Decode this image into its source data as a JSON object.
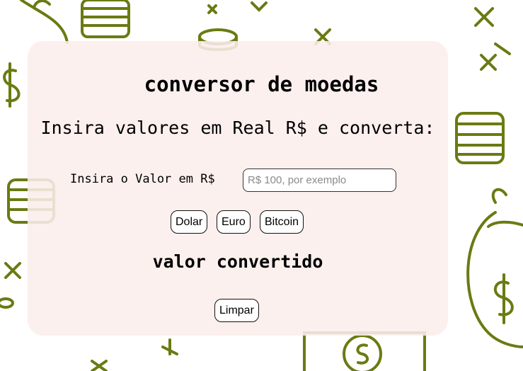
{
  "converter": {
    "title": "conversor de moedas",
    "subtitle": "Insira valores em Real R$ e converta:",
    "input_label": "Insira o Valor em R$",
    "input_placeholder": "R$ 100, por exemplo",
    "input_value": "",
    "buttons": {
      "dolar": "Dolar",
      "euro": "Euro",
      "bitcoin": "Bitcoin"
    },
    "result_text": "valor convertido",
    "clear_label": "Limpar"
  },
  "theme": {
    "icon_color": "#6b7a12",
    "card_color": "#faeeec"
  }
}
